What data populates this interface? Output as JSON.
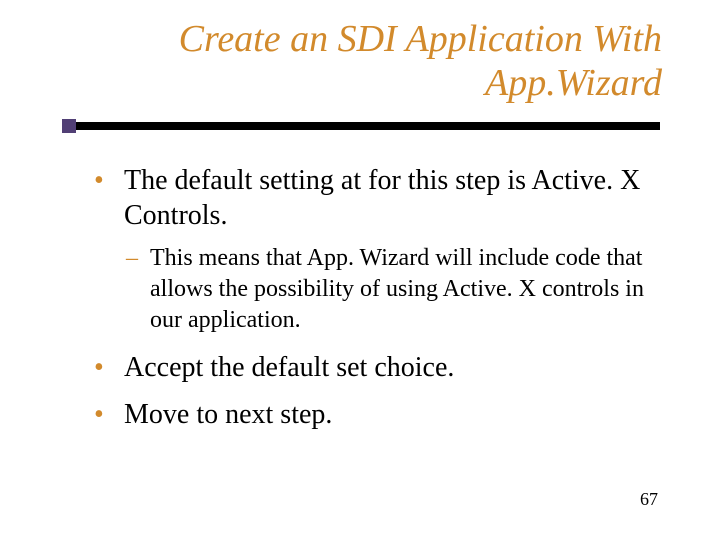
{
  "title_line1": "Create an SDI Application With",
  "title_line2": "App.Wizard",
  "bullets": [
    {
      "text": "The default setting at for this step is Active. X Controls.",
      "sub": [
        "This means that App. Wizard will include code that allows the possibility of using Active. X controls in our application."
      ]
    },
    {
      "text": "Accept the default set choice."
    },
    {
      "text": "Move to next step."
    }
  ],
  "page_number": "67"
}
